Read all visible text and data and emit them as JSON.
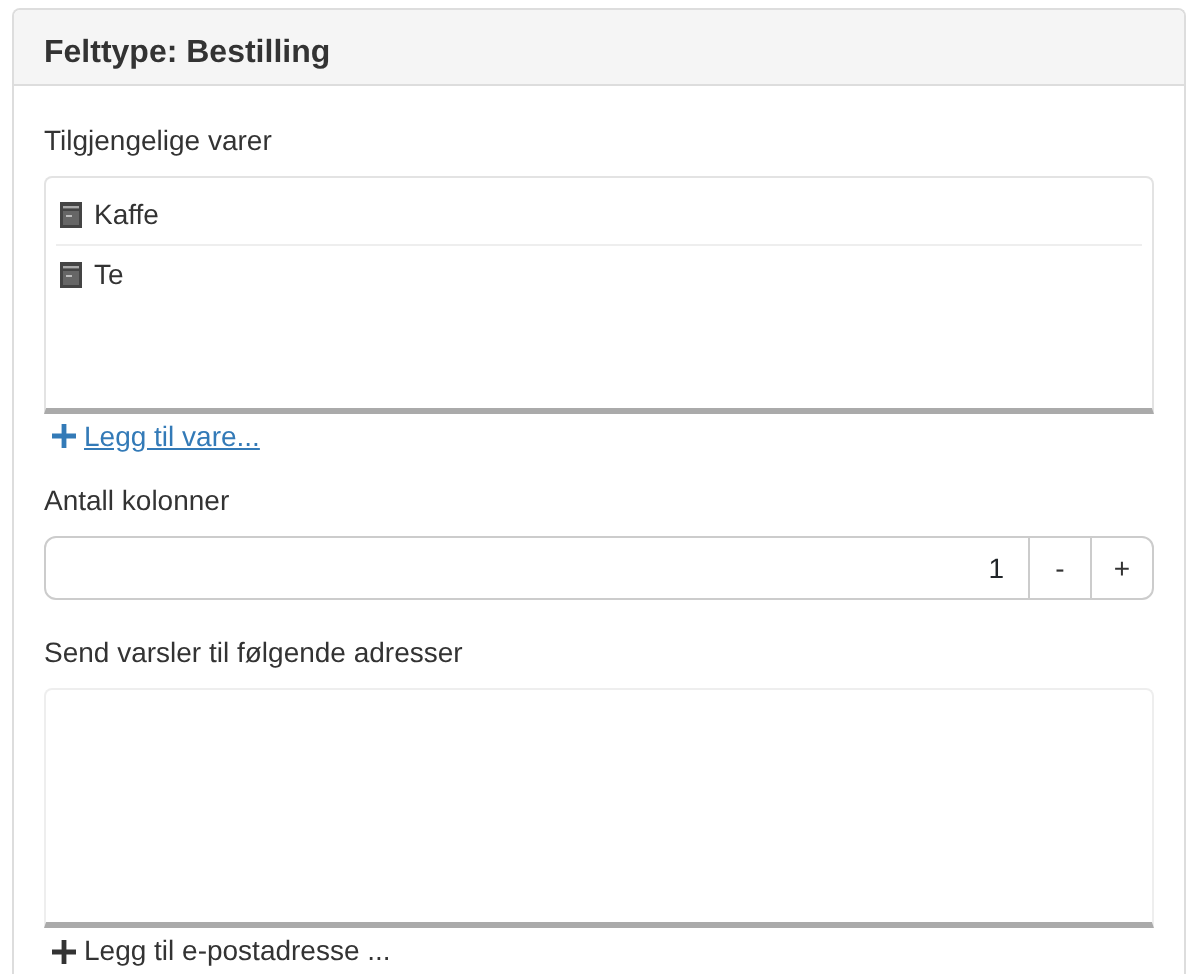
{
  "panel": {
    "title": "Felttype: Bestilling"
  },
  "items_section": {
    "label": "Tilgjengelige varer",
    "items": [
      {
        "name": "Kaffe"
      },
      {
        "name": "Te"
      }
    ],
    "add_link": {
      "text": "Legg til vare...",
      "underlined": true
    }
  },
  "columns": {
    "label": "Antall kolonner",
    "value": "1",
    "buttons": [
      "-",
      "+"
    ]
  },
  "notify_section": {
    "label": "Send varsler til følgende adresser",
    "add_link": {
      "text": "Legg til e-postadresse ...",
      "underlined": false
    }
  }
}
